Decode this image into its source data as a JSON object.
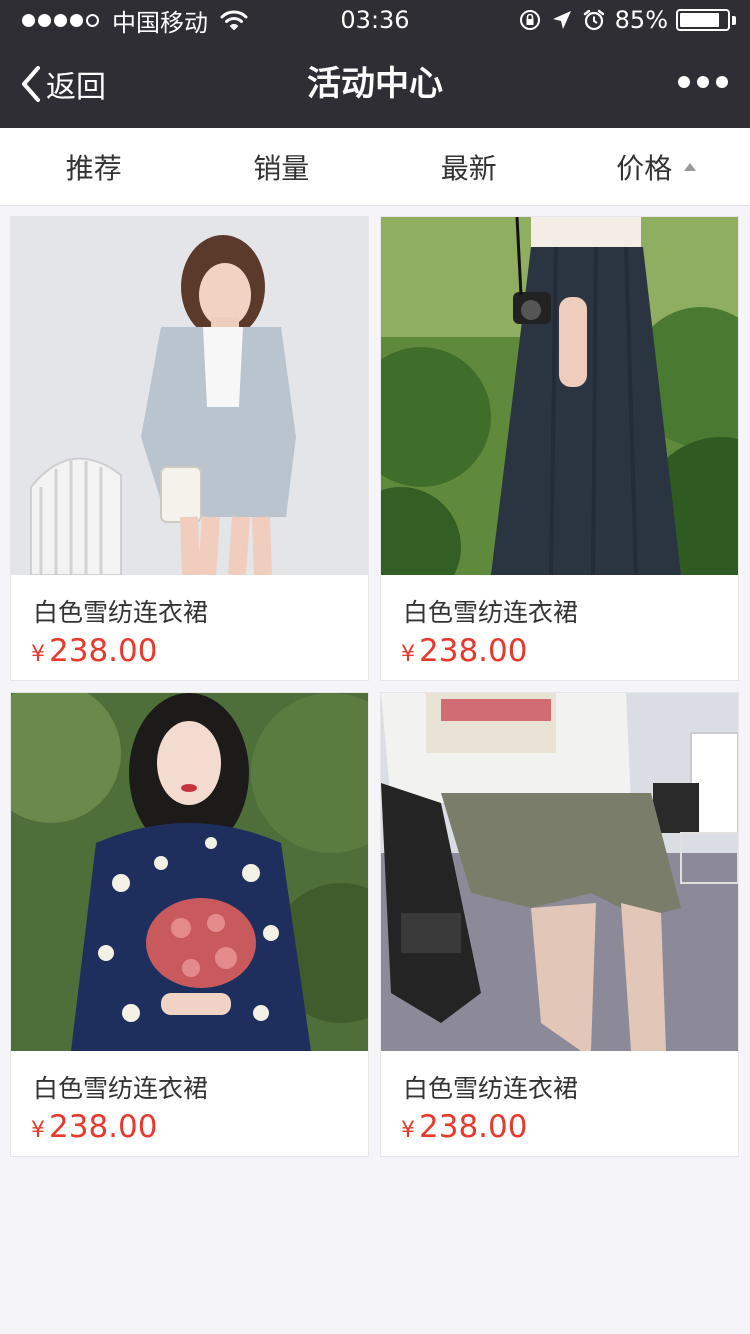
{
  "status_bar": {
    "carrier": "中国移动",
    "time": "03:36",
    "battery_percent": "85%",
    "battery_level": 0.85,
    "signal_bars_filled": 4,
    "signal_bars_total": 5
  },
  "nav": {
    "back_label": "返回",
    "title": "活动中心",
    "more_icon": "more-dots-icon"
  },
  "tabs": [
    {
      "label": "推荐"
    },
    {
      "label": "销量"
    },
    {
      "label": "最新"
    },
    {
      "label": "价格",
      "sort_icon": "sort-ascending-icon"
    }
  ],
  "products": [
    {
      "title": "白色雪纺连衣裙",
      "currency": "¥",
      "price": "238.00"
    },
    {
      "title": "白色雪纺连衣裙",
      "currency": "¥",
      "price": "238.00"
    },
    {
      "title": "白色雪纺连衣裙",
      "currency": "¥",
      "price": "238.00"
    },
    {
      "title": "白色雪纺连衣裙",
      "currency": "¥",
      "price": "238.00"
    }
  ],
  "colors": {
    "nav_background": "#2f2e34",
    "price_red": "#e8392d",
    "page_background": "#f5f5f9"
  }
}
